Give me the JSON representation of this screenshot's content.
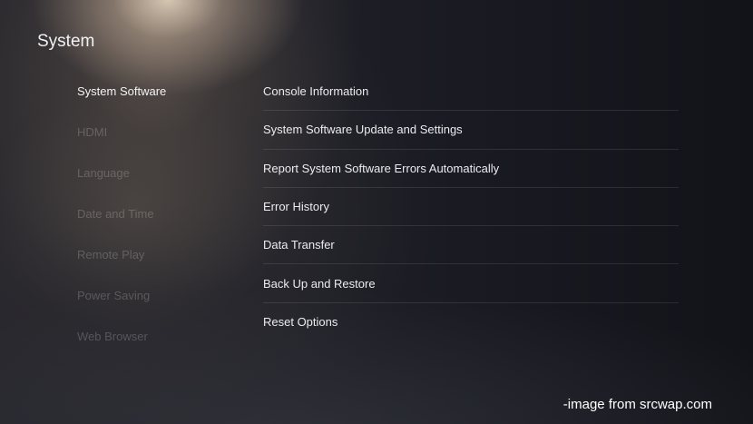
{
  "header": {
    "title": "System"
  },
  "sidebar": {
    "items": [
      {
        "label": "System Software",
        "selected": true
      },
      {
        "label": "HDMI",
        "selected": false
      },
      {
        "label": "Language",
        "selected": false
      },
      {
        "label": "Date and Time",
        "selected": false
      },
      {
        "label": "Remote Play",
        "selected": false
      },
      {
        "label": "Power Saving",
        "selected": false
      },
      {
        "label": "Web Browser",
        "selected": false
      }
    ]
  },
  "main": {
    "items": [
      {
        "label": "Console Information"
      },
      {
        "label": "System Software Update and Settings"
      },
      {
        "label": "Report System Software Errors Automatically"
      },
      {
        "label": "Error History"
      },
      {
        "label": "Data Transfer"
      },
      {
        "label": "Back Up and Restore"
      },
      {
        "label": "Reset Options"
      }
    ]
  },
  "watermark": {
    "text": "-image from srcwap.com"
  },
  "colors": {
    "background": "#15161c",
    "text_primary": "#ececef",
    "text_dimmed": "rgba(255,255,255,0.20)",
    "divider": "rgba(255,255,255,0.10)"
  }
}
